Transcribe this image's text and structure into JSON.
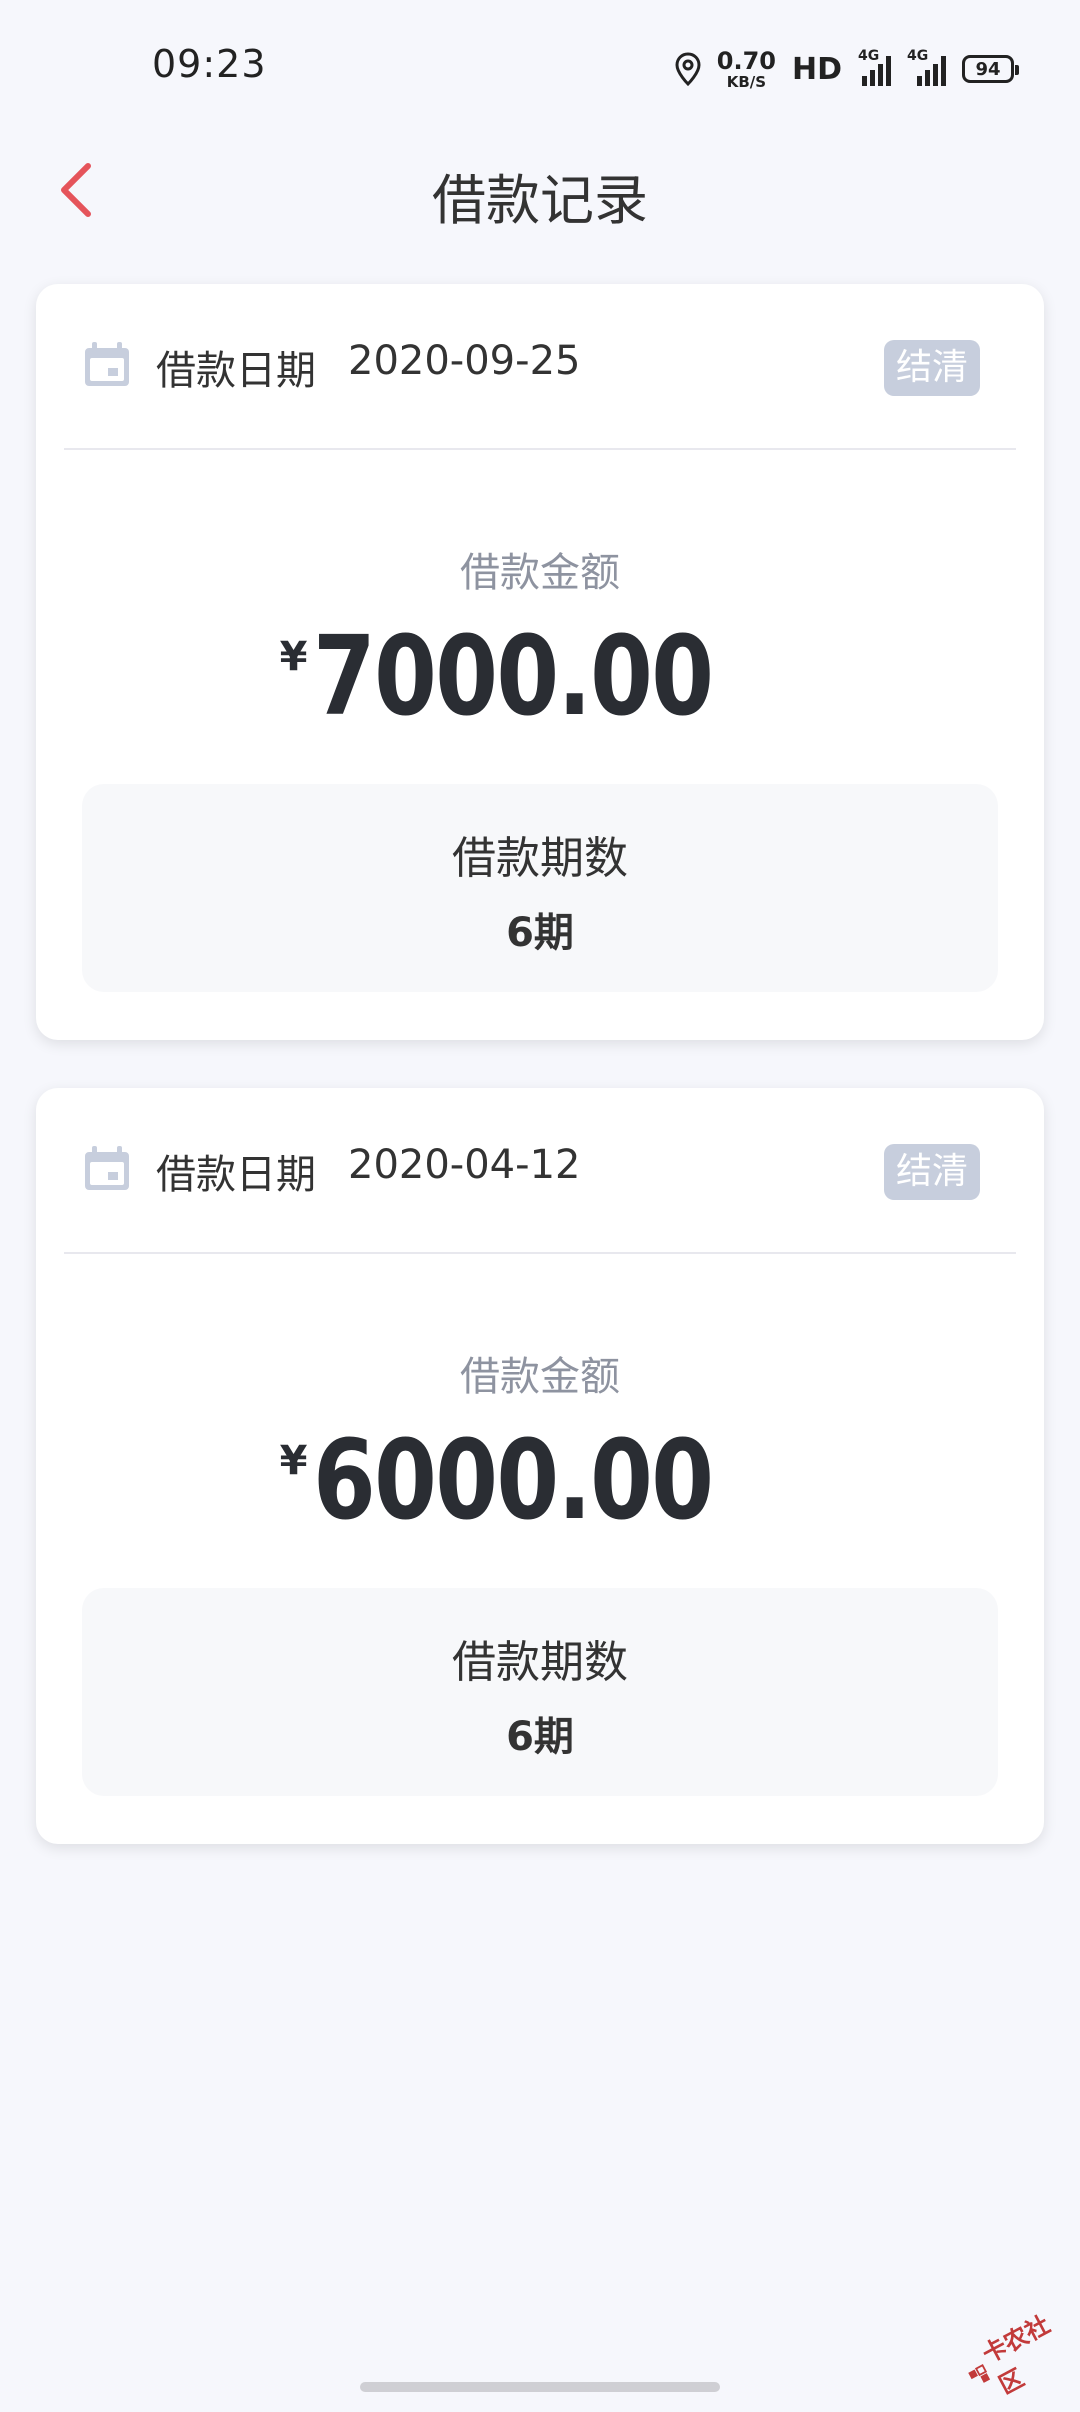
{
  "status_bar": {
    "time": "09:23",
    "net_speed_value": "0.70",
    "net_speed_unit": "KB/S",
    "hd": "HD",
    "signal1_label": "4G",
    "signal2_label": "4G",
    "battery": "94"
  },
  "nav": {
    "title": "借款记录"
  },
  "loans": [
    {
      "date_label": "借款日期",
      "date": "2020-09-25",
      "status": "结清",
      "amount_label": "借款金额",
      "currency": "¥",
      "amount": "7000.00",
      "term_label": "借款期数",
      "term": "6期"
    },
    {
      "date_label": "借款日期",
      "date": "2020-04-12",
      "status": "结清",
      "amount_label": "借款金额",
      "currency": "¥",
      "amount": "6000.00",
      "term_label": "借款期数",
      "term": "6期"
    }
  ],
  "watermark": {
    "text": "卡农社区"
  },
  "colors": {
    "back_arrow": "#E5545B",
    "badge_bg": "#C7CEDD",
    "calendar_icon": "#C7CEDD",
    "page_bg": "#F6F7FC"
  }
}
